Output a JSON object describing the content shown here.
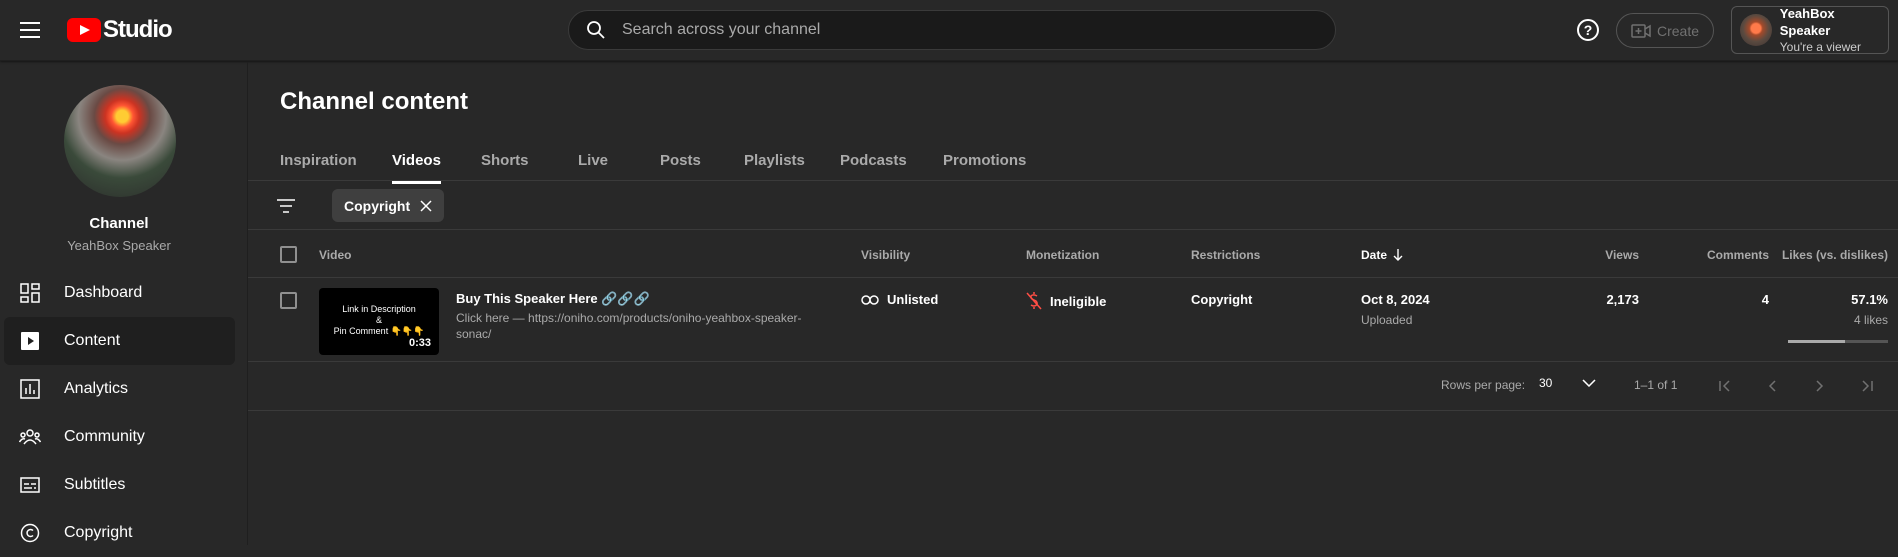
{
  "header": {
    "logo_text": "Studio",
    "search_placeholder": "Search across your channel",
    "help_label": "?",
    "create_label": "Create",
    "account_name": "YeahBox Speaker",
    "account_role": "You're a viewer"
  },
  "sidebar": {
    "channel_label": "Channel",
    "channel_name": "YeahBox Speaker",
    "items": [
      {
        "label": "Dashboard",
        "icon": "dashboard-icon"
      },
      {
        "label": "Content",
        "icon": "content-icon"
      },
      {
        "label": "Analytics",
        "icon": "analytics-icon"
      },
      {
        "label": "Community",
        "icon": "community-icon"
      },
      {
        "label": "Subtitles",
        "icon": "subtitles-icon"
      },
      {
        "label": "Copyright",
        "icon": "copyright-icon"
      }
    ]
  },
  "main": {
    "title": "Channel content",
    "tabs": [
      {
        "label": "Inspiration"
      },
      {
        "label": "Videos"
      },
      {
        "label": "Shorts"
      },
      {
        "label": "Live"
      },
      {
        "label": "Posts"
      },
      {
        "label": "Playlists"
      },
      {
        "label": "Podcasts"
      },
      {
        "label": "Promotions"
      }
    ],
    "active_tab": "Videos",
    "filter_chip": "Copyright",
    "columns": {
      "video": "Video",
      "visibility": "Visibility",
      "monetization": "Monetization",
      "restrictions": "Restrictions",
      "date": "Date",
      "views": "Views",
      "comments": "Comments",
      "likes": "Likes (vs. dislikes)"
    },
    "rows": [
      {
        "thumb_line1": "Link in Description",
        "thumb_line2": "&",
        "thumb_line3": "Pin Comment 👇👇👇",
        "duration": "0:33",
        "title": "Buy This Speaker Here 🔗🔗🔗",
        "description": "Click here — https://oniho.com/products/oniho-yeahbox-speaker-sonac/",
        "visibility": "Unlisted",
        "monetization": "Ineligible",
        "restrictions": "Copyright",
        "date": "Oct 8, 2024",
        "date_status": "Uploaded",
        "views": "2,173",
        "comments": "4",
        "likes_pct": "57.1%",
        "likes_count": "4 likes",
        "likes_fraction": 0.571
      }
    ],
    "pager": {
      "rows_label": "Rows per page:",
      "rows_value": "30",
      "range": "1–1 of 1"
    }
  }
}
